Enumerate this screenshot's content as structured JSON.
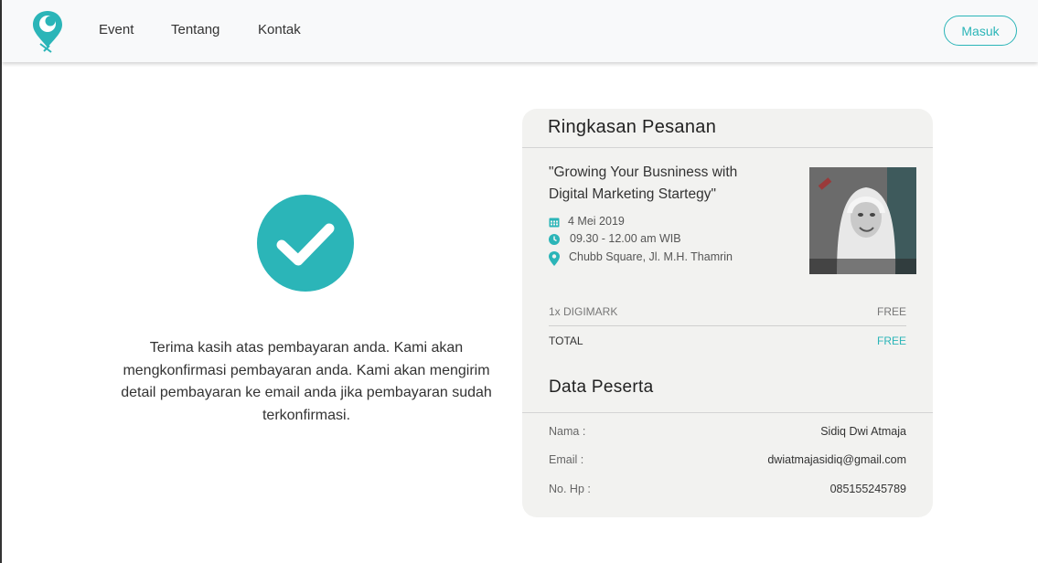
{
  "nav": {
    "links": [
      "Event",
      "Tentang",
      "Kontak"
    ],
    "login_label": "Masuk"
  },
  "colors": {
    "accent": "#2bb5b8"
  },
  "confirmation": {
    "message": "Terima kasih atas pembayaran anda. Kami akan mengkonfirmasi pembayaran anda. Kami akan mengirim detail pembayaran ke email anda jika pembayaran sudah terkonfirmasi."
  },
  "summary": {
    "title": "Ringkasan Pesanan",
    "event": {
      "title": "\"Growing Your Busniness with Digital Marketing Startegy\"",
      "date": "4 Mei 2019",
      "time": "09.30 - 12.00 am WIB",
      "location": "Chubb Square, Jl. M.H. Thamrin",
      "icons": [
        "calendar-icon",
        "clock-icon",
        "location-pin-icon"
      ]
    },
    "ticket": {
      "label": "1x DIGIMARK",
      "price": "FREE"
    },
    "total": {
      "label": "TOTAL",
      "price": "FREE"
    }
  },
  "participant": {
    "title": "Data Peserta",
    "rows": [
      {
        "label": "Nama :",
        "value": "Sidiq Dwi Atmaja"
      },
      {
        "label": "Email :",
        "value": "dwiatmajasidiq@gmail.com"
      },
      {
        "label": "No. Hp :",
        "value": "085155245789"
      }
    ]
  }
}
